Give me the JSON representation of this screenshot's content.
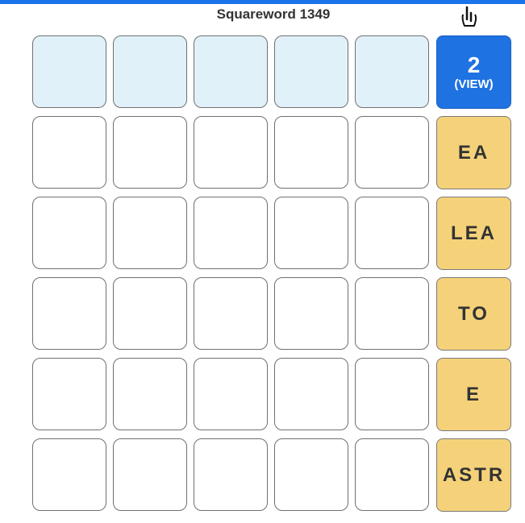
{
  "header": {
    "title": "Squareword 1349",
    "accent_color": "#1a73e8"
  },
  "grid": {
    "rows": 6,
    "cols": 5,
    "highlighted_row": 0,
    "cell_values": [
      [
        "",
        "",
        "",
        "",
        ""
      ],
      [
        "",
        "",
        "",
        "",
        ""
      ],
      [
        "",
        "",
        "",
        "",
        ""
      ],
      [
        "",
        "",
        "",
        "",
        ""
      ],
      [
        "",
        "",
        "",
        "",
        ""
      ],
      [
        "",
        "",
        "",
        "",
        ""
      ]
    ]
  },
  "guess_count": {
    "value": "2",
    "label": "(VIEW)",
    "color": "#1f72e2"
  },
  "row_hints": [
    "EA",
    "LEA",
    "TO",
    "E",
    "ASTR"
  ],
  "hint_color": "#f5d27a",
  "cursor_icon": "hand-pointer-icon"
}
